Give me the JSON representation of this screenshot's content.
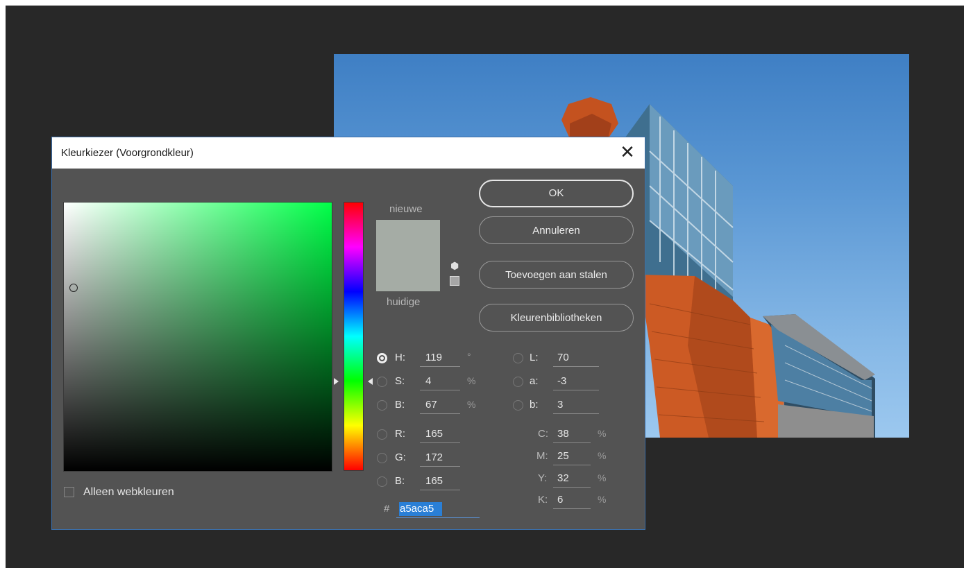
{
  "dialog": {
    "title": "Kleurkiezer (Voorgrondkleur)",
    "close": "✕",
    "label_new": "nieuwe",
    "label_current": "huidige",
    "new_color": "#a5aca5",
    "current_color": "#a5aca5",
    "buttons": {
      "ok": "OK",
      "cancel": "Annuleren",
      "add_swatches": "Toevoegen aan stalen",
      "libraries": "Kleurenbibliotheken"
    },
    "fields": {
      "H": {
        "label": "H:",
        "value": "119",
        "unit": "°"
      },
      "S": {
        "label": "S:",
        "value": "4",
        "unit": "%"
      },
      "Bv": {
        "label": "B:",
        "value": "67",
        "unit": "%"
      },
      "R": {
        "label": "R:",
        "value": "165"
      },
      "G": {
        "label": "G:",
        "value": "172"
      },
      "Bb": {
        "label": "B:",
        "value": "165"
      },
      "L": {
        "label": "L:",
        "value": "70"
      },
      "a": {
        "label": "a:",
        "value": "-3"
      },
      "b": {
        "label": "b:",
        "value": "3"
      },
      "C": {
        "label": "C:",
        "value": "38",
        "unit": "%"
      },
      "M": {
        "label": "M:",
        "value": "25",
        "unit": "%"
      },
      "Y": {
        "label": "Y:",
        "value": "32",
        "unit": "%"
      },
      "K": {
        "label": "K:",
        "value": "6",
        "unit": "%"
      }
    },
    "hex": {
      "hash": "#",
      "value": "a5aca5"
    },
    "webonly_label": "Alleen webkleuren",
    "selected_mode": "H",
    "cube_icon": "cube-icon",
    "colors": {
      "dialog_bg": "#535353",
      "accent": "#2a7fd6",
      "workspace": "#282828"
    }
  }
}
